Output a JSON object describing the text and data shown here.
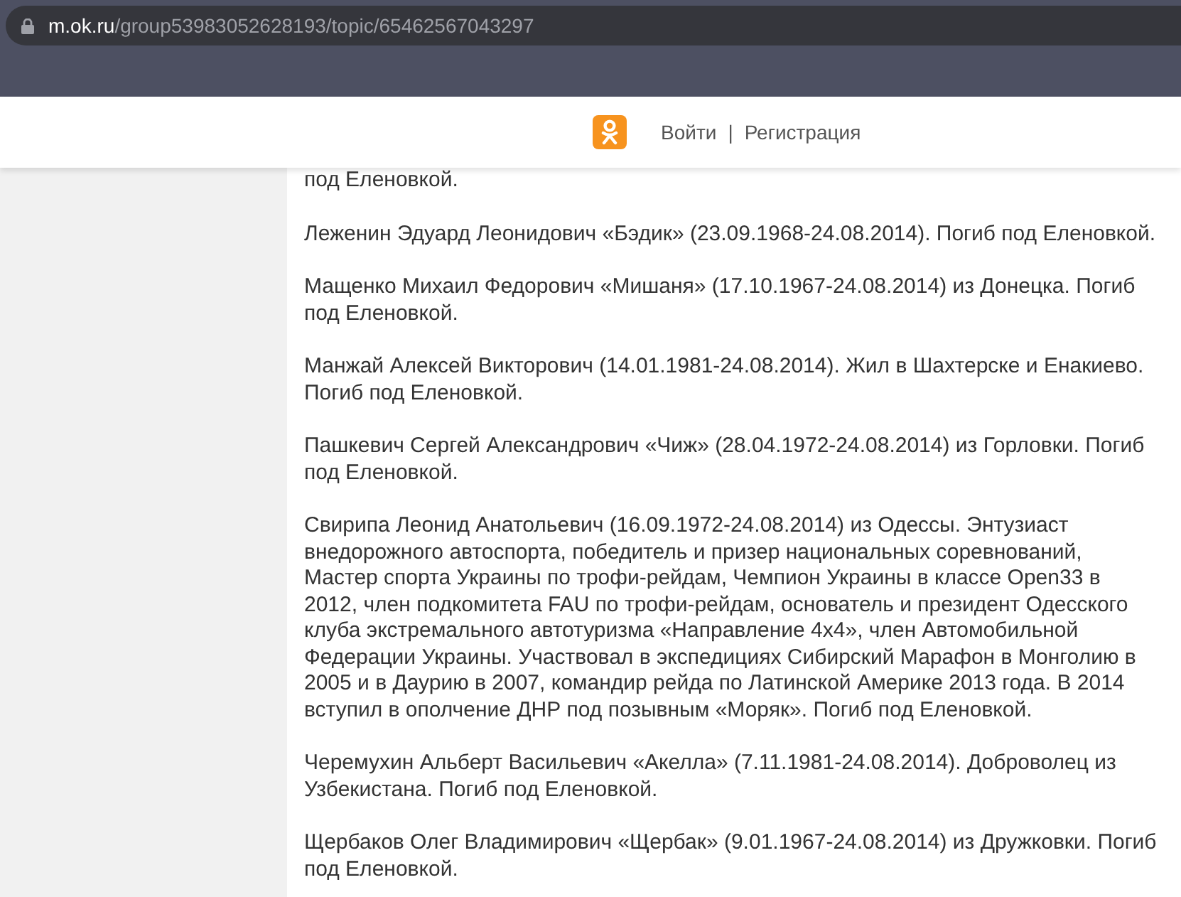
{
  "browser": {
    "url_host": "m.ok.ru",
    "url_path": "/group53983052628193/topic/65462567043297"
  },
  "header": {
    "links": [
      "Войти",
      "Регистрация"
    ],
    "separator": "|"
  },
  "paragraphs": [
    "под Еленовкой.",
    "Леженин Эдуард Леонидович «Бэдик» (23.09.1968-24.08.2014). Погиб под Еленовкой.",
    "Мащенко Михаил Федорович «Мишаня» (17.10.1967-24.08.2014) из Донецка. Погиб под Еленовкой.",
    "Манжай Алексей Викторович (14.01.1981-24.08.2014). Жил в Шахтерске и Енакиево. Погиб под Еленовкой.",
    "Пашкевич Сергей Александрович «Чиж» (28.04.1972-24.08.2014) из Горловки. Погиб под Еленовкой.",
    "Свирипа Леонид Анатольевич (16.09.1972-24.08.2014) из Одессы. Энтузиаст внедорожного автоспорта, победитель и призер национальных соревнований, Мастер спорта Украины по трофи-рейдам, Чемпион Украины в классе Open33 в 2012, член подкомитета FAU по трофи-рейдам, основатель и президент Одесского клуба экстремального автотуризма «Направление 4x4», член Автомобильной Федерации Украины. Участвовал в экспедициях Сибирский Марафон в Монголию в 2005 и в Даурию в 2007, командир рейда по Латинской Америке 2013 года. В 2014 вступил в ополчение ДНР под позывным «Моряк». Погиб под Еленовкой.",
    "Черемухин Альберт Васильевич «Акелла» (7.11.1981-24.08.2014). Доброволец из Узбекистана. Погиб под Еленовкой.",
    "Щербаков Олег Владимирович «Щербак» (9.01.1967-24.08.2014) из Дружковки. Погиб под Еленовкой."
  ]
}
